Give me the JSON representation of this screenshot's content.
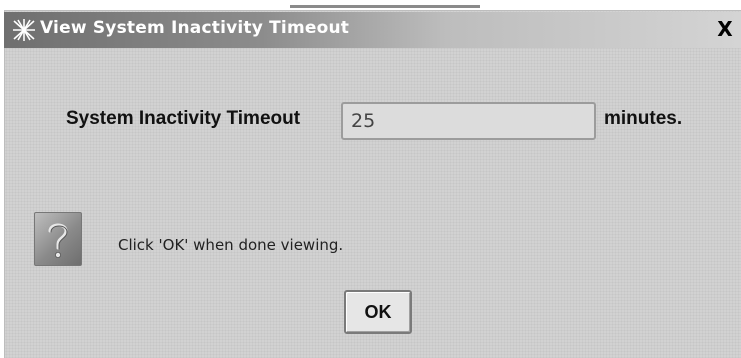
{
  "window": {
    "title": "View System Inactivity Timeout",
    "close_label": "X",
    "icon": "java-cup-icon"
  },
  "form": {
    "timeout_label": "System Inactivity Timeout",
    "timeout_value": "25",
    "unit_label": "minutes."
  },
  "info": {
    "icon": "question-mark-icon",
    "message": "Click 'OK' when done viewing."
  },
  "buttons": {
    "ok_label": "OK"
  }
}
